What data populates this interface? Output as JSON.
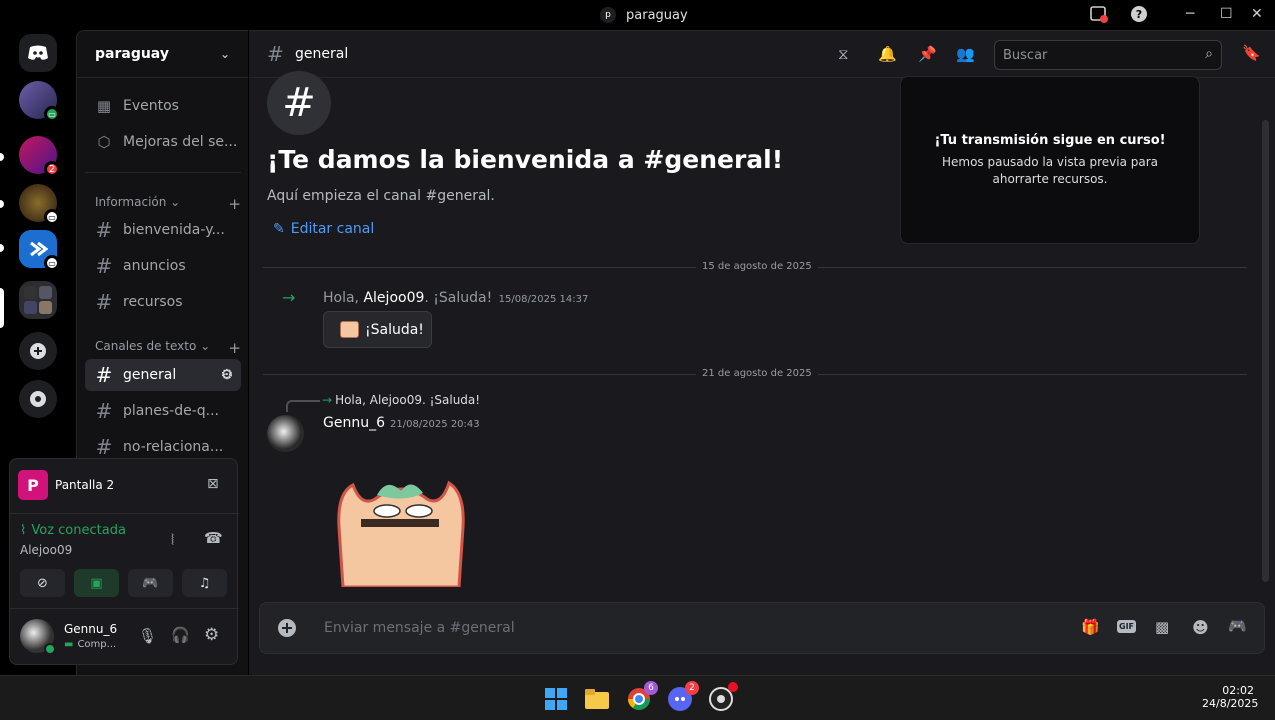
{
  "window": {
    "title": "paraguay",
    "badge_letter": "p"
  },
  "server": {
    "name": "paraguay"
  },
  "servers": [
    {
      "name": "Discord",
      "badge": ""
    },
    {
      "name": "server-1",
      "badge": ""
    },
    {
      "name": "server-2",
      "badge": "2"
    },
    {
      "name": "server-3",
      "badge": ""
    },
    {
      "name": "server-4",
      "badge": ""
    },
    {
      "name": "server-folder",
      "badge": ""
    }
  ],
  "sidebar": {
    "events": "Eventos",
    "boosts": "Mejoras del se...",
    "cat_info": "Información",
    "channels_info": [
      "bienvenida-y...",
      "anuncios",
      "recursos"
    ],
    "cat_text": "Canales de texto",
    "channels_text": [
      "general",
      "planes-de-q...",
      "no-relaciona..."
    ]
  },
  "stream": {
    "screen": "Pantalla 2",
    "status": "Voz conectada",
    "user": "Alejoo09"
  },
  "user": {
    "name": "Gennu_6",
    "status": "Comp..."
  },
  "channel": {
    "name": "general"
  },
  "search": {
    "placeholder": "Buscar"
  },
  "welcome": {
    "title": "¡Te damos la bienvenida a #general!",
    "subtitle": "Aquí empieza el canal #general.",
    "edit": "Editar canal"
  },
  "popup": {
    "title": "¡Tu transmisión sigue en curso!",
    "body": "Hemos pausado la vista previa para ahorrarte recursos."
  },
  "messages": {
    "date1": "15 de agosto de 2025",
    "join_text": "Hola,",
    "join_user": "Alejoo09",
    "join_rest": ". ¡Saluda!",
    "join_time": "15/08/2025 14:37",
    "wave_button": "¡Saluda!",
    "date2": "21 de agosto de 2025",
    "reply_ref": "Hola, Alejoo09. ¡Saluda!",
    "author": "Gennu_6",
    "time": "21/08/2025 20:43"
  },
  "composer": {
    "placeholder": "Enviar mensaje a #general",
    "gif": "GIF"
  },
  "taskbar": {
    "time": "02:02",
    "date": "24/8/2025",
    "chrome_badge": "6",
    "discord_badge": "2"
  }
}
